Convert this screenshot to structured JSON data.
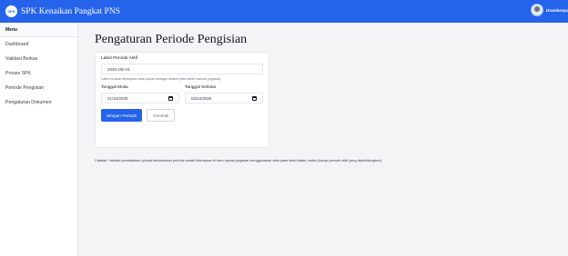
{
  "header": {
    "logo_text": "SPK",
    "title": "SPK Kenaikan Pangkat PNS",
    "user_name": "Dramberpu"
  },
  "sidebar": {
    "title": "Menu",
    "items": [
      {
        "label": "Dashboard"
      },
      {
        "label": "Validasi Berkas"
      },
      {
        "label": "Proses SPK"
      },
      {
        "label": "Periode Pengisian"
      },
      {
        "label": "Pengaturan Dokumen"
      }
    ]
  },
  "main": {
    "title": "Pengaturan Periode Pengisian",
    "form": {
      "label_field": {
        "label": "Label Periode Aktif",
        "value": "2025-Okt-01",
        "help": "Label ini akan ditetapkan saat upload sebagai default (bisa diedit manual pegawai)."
      },
      "start_date": {
        "label": "Tanggal Mulai",
        "value": "01/10/2025"
      },
      "end_date": {
        "label": "Tanggal Selesai",
        "value": "03/10/2025"
      },
      "save_label": "Simpan Periode",
      "back_label": "Kembali"
    },
    "note": "Catatan: Validasi pembatasan upload berdasarkan periode sudah diterapkan di form upload pegawai menggunakan data pada tabel batas, waktu (hanya periode aktif yang diperhitungkan)."
  }
}
